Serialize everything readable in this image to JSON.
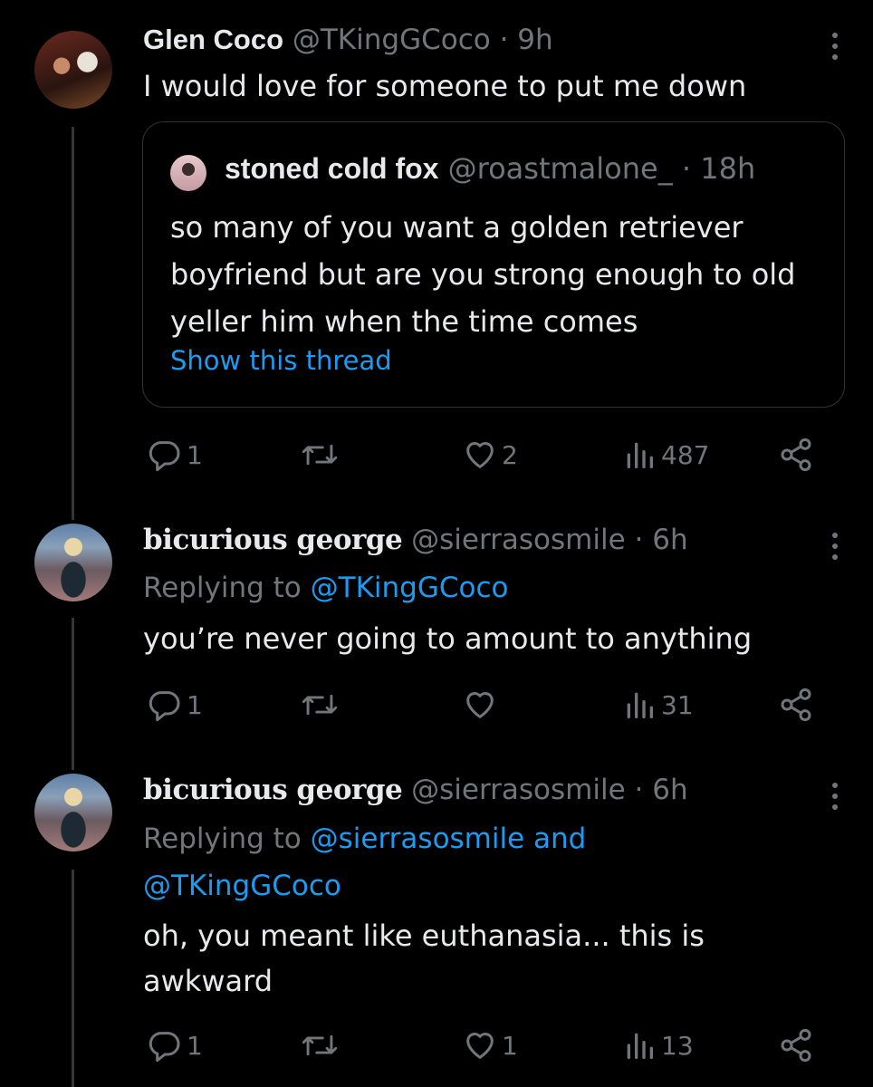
{
  "tweets": [
    {
      "name": "Glen Coco",
      "handle": "@TKingGCoco",
      "time": "· 9h",
      "text": "I would love for someone to put me down",
      "quote": {
        "name": "stoned cold fox",
        "handle": "@roastmalone_",
        "time": "· 18h",
        "text": "so many of you want a golden retriever boyfriend but are you strong enough to old yeller him when the time comes",
        "show_thread": "Show this thread"
      },
      "replies": "1",
      "likes": "2",
      "views": "487"
    },
    {
      "name": "bicurious george",
      "handle": "@sierrasosmile",
      "time": "· 6h",
      "replying_prefix": "Replying to",
      "replying_to": "@TKingGCoco",
      "text": "you’re never going to amount to anything",
      "replies": "1",
      "likes": "",
      "views": "31"
    },
    {
      "name": "bicurious george",
      "handle": "@sierrasosmile",
      "time": "· 6h",
      "replying_prefix": "Replying to",
      "replying_to": "@sierrasosmile and",
      "replying_to_2": "@TKingGCoco",
      "text": "oh, you meant like euthanasia... this is awkward",
      "replies": "1",
      "likes": "1",
      "views": "13"
    }
  ],
  "icons": {
    "reply": "reply-icon",
    "retweet": "retweet-icon",
    "like": "heart-icon",
    "views": "views-icon",
    "share": "share-icon",
    "more": "more-icon"
  },
  "colors": {
    "background": "#000000",
    "text": "#e7e9ea",
    "muted": "#71767b",
    "link": "#1d9bf0",
    "border": "#2f3336"
  }
}
